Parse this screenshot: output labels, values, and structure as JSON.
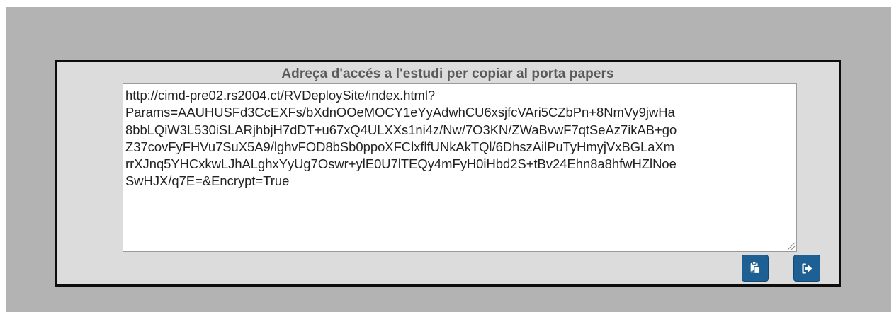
{
  "dialog": {
    "title": "Adreça d'accés a l'estudi per copiar al porta papers",
    "url_value": "http://cimd-pre02.rs2004.ct/RVDeploySite/index.html?\nParams=AAUHUSFd3CcEXFs/bXdnOOeMOCY1eYyAdwhCU6xsjfcVAri5CZbPn+8NmVy9jwHa\n8bbLQiW3L530iSLARjhbjH7dDT+u67xQ4ULXXs1ni4z/Nw/7O3KN/ZWaBvwF7qtSeAz7ikAB+go\nZ37covFyFHVu7SuX5A9/lghvFOD8bSb0ppoXFClxflfUNkAkTQl/6DhszAilPuTyHmyjVxBGLaXm\nrrXJnq5YHCxkwLJhALghxYyUg7Oswr+ylE0U7lTEQy4mFyH0iHbd2S+tBv24Ehn8a8hfwHZlNoe\nSwHJX/q7E=&Encrypt=True"
  },
  "buttons": {
    "copy_icon": "clipboard-paste-icon",
    "exit_icon": "sign-out-icon"
  },
  "colors": {
    "overlay": "#b3b3b3",
    "dialog_background": "#dcdcdc",
    "button_background": "#1e5f94",
    "title_text": "#5a5a5a"
  }
}
